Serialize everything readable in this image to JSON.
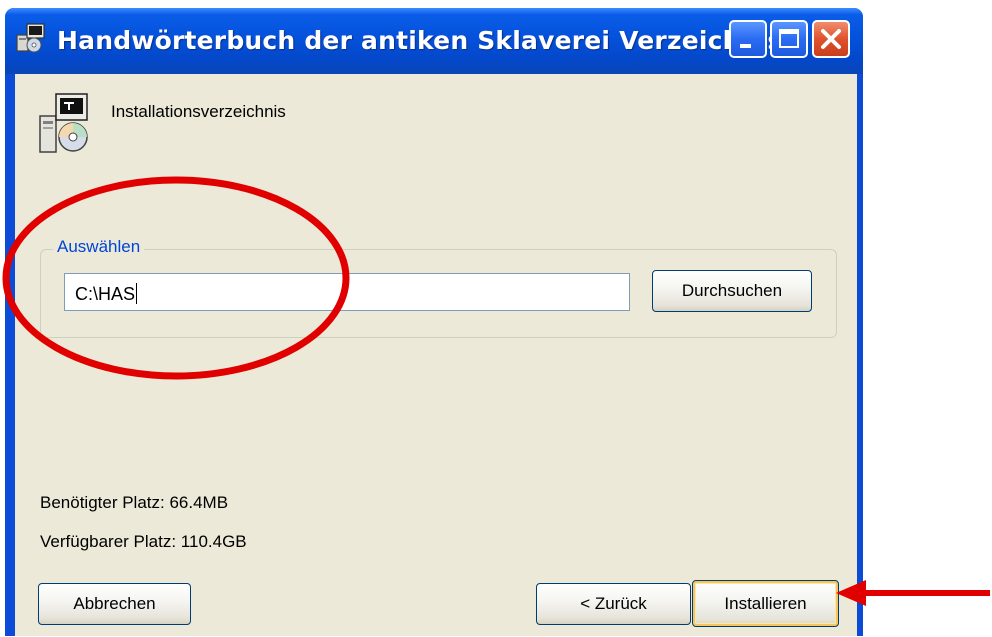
{
  "window": {
    "title": "Handwörterbuch der antiken Sklaverei  Verzeichnis",
    "buttons": [
      "minimize",
      "maximize",
      "close"
    ]
  },
  "header": {
    "section_title": "Installationsverzeichnis",
    "icon": "setup-computer-cd-icon"
  },
  "directory": {
    "group_label": "Auswählen",
    "path_value": "C:\\HAS",
    "browse_label": "Durchsuchen"
  },
  "space": {
    "required": "Benötigter Platz: 66.4MB",
    "available": "Verfügbarer Platz: 110.4GB"
  },
  "footer": {
    "cancel_label": "Abbrechen",
    "back_label": "< Zurück",
    "install_label": "Installieren"
  },
  "colors": {
    "title_bar": "#0553dd",
    "dialog_background": "#ece9d8",
    "group_label": "#0046d5",
    "annotation": "#e00000",
    "default_button_highlight": "#f7c65a"
  }
}
